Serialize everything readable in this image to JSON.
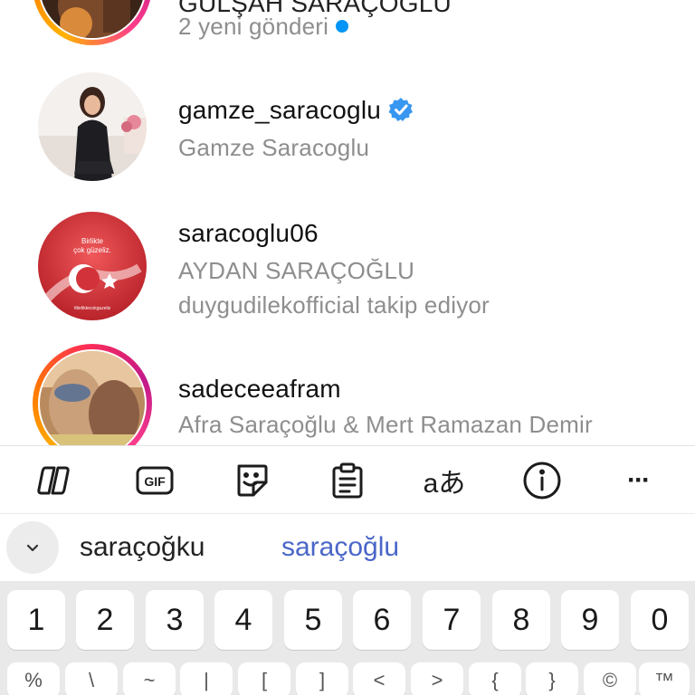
{
  "results": [
    {
      "username": "GÜLŞAH SARAÇOĞLU",
      "subtitle": "2 yeni gönderi",
      "has_new_dot": true,
      "story_ring": true
    },
    {
      "username": "gamze_saracoglu",
      "verified": true,
      "subtitle": "Gamze Saracoglu"
    },
    {
      "username": "saracoglu06",
      "subtitle": "AYDAN SARAÇOĞLU",
      "subtitle2": "duygudilekofficial takip ediyor",
      "avatar_text_line1": "Birlikte",
      "avatar_text_line2": "çok güzeliz.",
      "avatar_text_tag": "#birliktecokguzeliz"
    },
    {
      "username": "sadeceeafram",
      "subtitle": "Afra Saraçoğlu & Mert Ramazan Demir",
      "story_ring": true
    }
  ],
  "toolbar": {
    "items": [
      "copilot-icon",
      "gif-icon",
      "sticker-icon",
      "clipboard-icon",
      "translate-icon",
      "info-icon",
      "more-icon"
    ],
    "gif_label": "GIF",
    "translate_label": "aあ",
    "more_label": "···"
  },
  "suggestions": {
    "word1": "saraçoğku",
    "word2": "saraçoğlu",
    "highlight_color": "#4a66c8"
  },
  "keyboard": {
    "number_row": [
      "1",
      "2",
      "3",
      "4",
      "5",
      "6",
      "7",
      "8",
      "9",
      "0"
    ],
    "symbol_row": [
      "%",
      "\\",
      "~",
      "|",
      "[",
      "]",
      "<",
      ">",
      "{",
      "}",
      "©",
      "™"
    ]
  },
  "colors": {
    "link_blue": "#0095f6",
    "secondary_text": "#8e8e8e",
    "story_ring": [
      "#ffb300",
      "#ff2d55",
      "#c2198a"
    ]
  }
}
